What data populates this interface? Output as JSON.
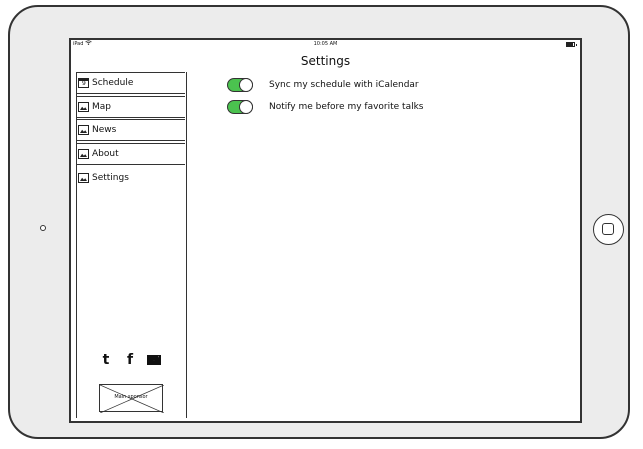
{
  "status_bar": {
    "device": "iPad",
    "time": "10:05 AM"
  },
  "page": {
    "title": "Settings"
  },
  "sidebar": {
    "items": [
      {
        "label": "Schedule",
        "icon": "calendar-icon"
      },
      {
        "label": "Map",
        "icon": "image-icon"
      },
      {
        "label": "News",
        "icon": "image-icon"
      },
      {
        "label": "About",
        "icon": "image-icon"
      },
      {
        "label": "Settings",
        "icon": "image-icon"
      }
    ],
    "social": [
      "twitter-icon",
      "facebook-icon",
      "mail-icon"
    ],
    "sponsor": {
      "label": "Main sponsor"
    }
  },
  "settings": [
    {
      "label": "Sync my schedule with iCalendar",
      "enabled": true
    },
    {
      "label": "Notify me before my favorite talks",
      "enabled": true
    }
  ],
  "colors": {
    "toggle_on": "#4bc24f"
  }
}
